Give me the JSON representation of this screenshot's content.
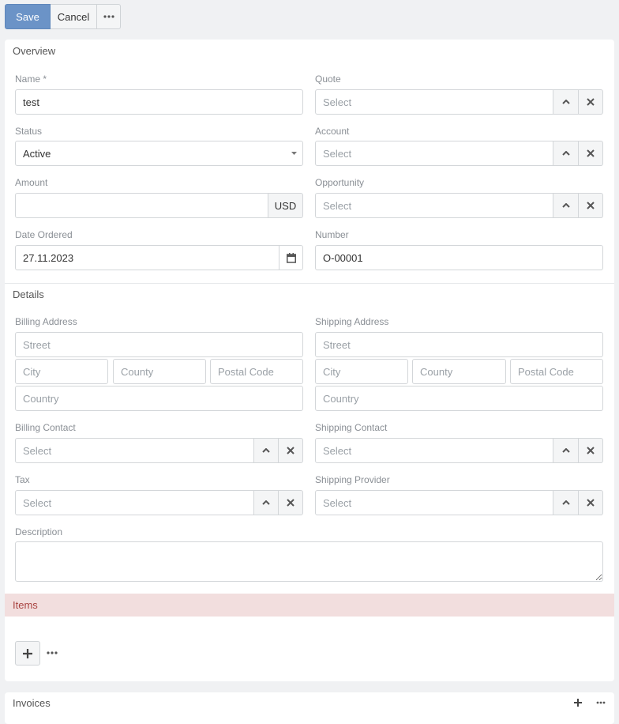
{
  "toolbar": {
    "save_label": "Save",
    "cancel_label": "Cancel"
  },
  "overview": {
    "title": "Overview",
    "name": {
      "label": "Name *",
      "value": "test"
    },
    "quote": {
      "label": "Quote",
      "placeholder": "Select"
    },
    "status": {
      "label": "Status",
      "value": "Active"
    },
    "account": {
      "label": "Account",
      "placeholder": "Select"
    },
    "amount": {
      "label": "Amount",
      "value": "",
      "currency": "USD"
    },
    "opportunity": {
      "label": "Opportunity",
      "placeholder": "Select"
    },
    "date_ordered": {
      "label": "Date Ordered",
      "value": "27.11.2023"
    },
    "number": {
      "label": "Number",
      "value": "O-00001"
    }
  },
  "details": {
    "title": "Details",
    "billing_address": {
      "label": "Billing Address",
      "street": "Street",
      "city": "City",
      "county": "County",
      "postal_code": "Postal Code",
      "country": "Country"
    },
    "shipping_address": {
      "label": "Shipping Address",
      "street": "Street",
      "city": "City",
      "county": "County",
      "postal_code": "Postal Code",
      "country": "Country"
    },
    "billing_contact": {
      "label": "Billing Contact",
      "placeholder": "Select"
    },
    "shipping_contact": {
      "label": "Shipping Contact",
      "placeholder": "Select"
    },
    "tax": {
      "label": "Tax",
      "placeholder": "Select"
    },
    "shipping_provider": {
      "label": "Shipping Provider",
      "placeholder": "Select"
    },
    "description": {
      "label": "Description",
      "value": ""
    }
  },
  "items": {
    "title": "Items"
  },
  "invoices": {
    "title": "Invoices"
  },
  "colors": {
    "primary": "#6b93c7",
    "items_bg": "#f2dede",
    "items_text": "#a94442"
  }
}
